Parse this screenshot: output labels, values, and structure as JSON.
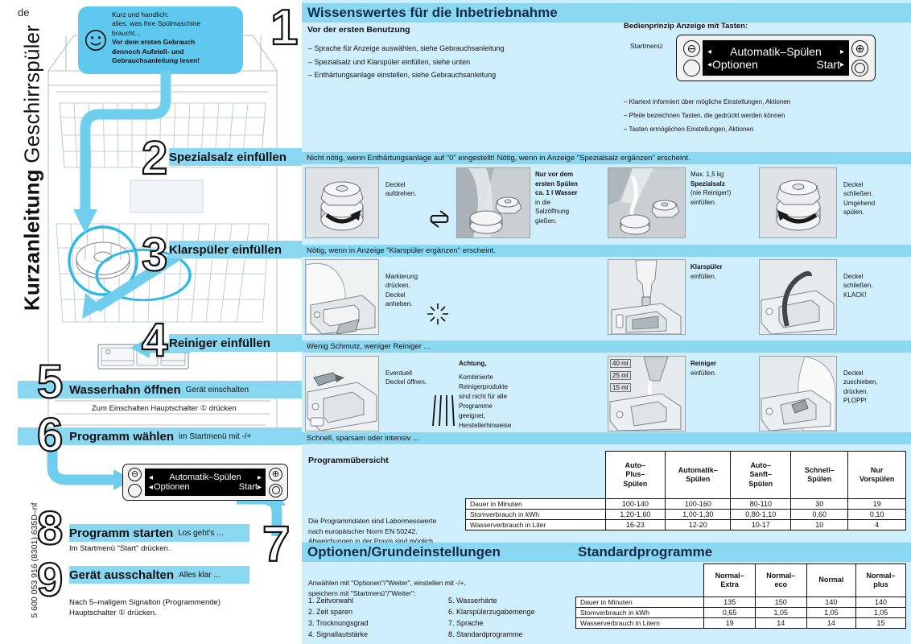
{
  "meta": {
    "language_code": "de",
    "doc_code": "5 600 053 916 (8301)   635D–nf",
    "vertical_title_bold": "Kurzanleitung",
    "vertical_title_thin": "Geschirrspüler"
  },
  "intro_bubble": {
    "icon": "smiley-icon",
    "line1": "Kurz und handlich:",
    "line2": "alles, was Ihre Spülmaschine",
    "line3": "braucht...",
    "bold1": "Vor dem ersten Gebrauch",
    "bold2": "dennoch Aufstell- und",
    "bold3": "Gebrauchsanleitung lesen!"
  },
  "steps": [
    {
      "num": "1",
      "title": "",
      "sub": "",
      "note": ""
    },
    {
      "num": "2",
      "title": "Spezialsalz einfüllen",
      "sub": "",
      "note": ""
    },
    {
      "num": "3",
      "title": "Klarspüler einfüllen",
      "sub": "",
      "note": ""
    },
    {
      "num": "4",
      "title": "Reiniger einfüllen",
      "sub": "",
      "note": ""
    },
    {
      "num": "5",
      "title": "Wasserhahn öffnen",
      "sub": "Gerät einschalten",
      "note": "Zum Einschalten Hauptschalter ① drücken"
    },
    {
      "num": "6",
      "title": "Programm wählen",
      "sub": "im Startmenü mit -/+",
      "note": ""
    },
    {
      "num": "7",
      "title": "",
      "sub": "",
      "note": ""
    },
    {
      "num": "8",
      "title": "Programm starten",
      "sub": "Los geht's ...",
      "note": "Im Startmenü \"Start\" drücken."
    },
    {
      "num": "9",
      "title": "Gerät ausschalten",
      "sub": "Alles klar ...",
      "note": "Nach 5–maligem Signalton (Programmende)\nHauptschalter ① drücken."
    }
  ],
  "display": {
    "minus": "⊖",
    "plus": "⊕",
    "blank_button": "blank-button",
    "ring_button": "ring-button",
    "row1_left_arrow": "◂",
    "row1_text": "Automatik–Spülen",
    "row1_right_arrow": "▸",
    "row2_left_arrow": "◂",
    "row2_text": "Optionen",
    "row2_right_text": "Start",
    "row2_right_arrow": "▸"
  },
  "section1": {
    "title": "Wissenswertes für die Inbetriebnahme",
    "subhead": "Vor der ersten Benutzung",
    "bullets": [
      "– Sprache für Anzeige auswählen, siehe Gebrauchsanleitung",
      "– Spezialsalz und Klarspüler einfüllen, siehe unten",
      "– Enthärtungsanlage einstellen, siehe Gebrauchsanleitung"
    ],
    "bedien_head": "Bedienprinzip Anzeige mit Tasten:",
    "startmenu_label": "Startmenü:",
    "bedien_notes": [
      "– Klartext informiert über mögliche Einstellungen, Aktionen",
      "– Pfeile bezeichnen Tasten, die gedrückt werden können",
      "– Tasten ermöglichen Einstellungen, Aktionen"
    ]
  },
  "row_salt": {
    "band": "Nicht nötig, wenn Enthärtungsanlage auf \"0\" eingestellt! Nötig, wenn in Anzeige \"Spezialsalz ergänzen\" erscheint.",
    "cap1": "Deckel\naufdrehen.",
    "cap2_bold": "Nur vor dem\nersten Spülen\nca. 1 l Wasser",
    "cap2_rest": "in die\nSalzöffnung\ngießen.",
    "cap3_pre": "Max. 1,5 kg",
    "cap3_bold": "Spezialsalz",
    "cap3_rest": "(nie Reiniger!)\neinfüllen.",
    "cap4": "Deckel\nschließen.\nUmgehend\nspülen.",
    "swap_icon": "swap-arrows-icon"
  },
  "row_rinse": {
    "band": "Nötig, wenn in Anzeige \"Klarspüler ergänzen\" erscheint.",
    "cap1": "Markierung\ndrücken,\nDeckel\nanheben.",
    "cap2_bold": "Klarspüler",
    "cap2_rest": "einfüllen.",
    "cap3": "Deckel\nschließen.\nKLACK!",
    "sparkle_icon": "sparkle-icon"
  },
  "row_detergent": {
    "band": "Wenig Schmutz, weniger Reiniger ...",
    "cap1": "Eventuell\nDeckel öffnen.",
    "cap2_bold": "Achtung,",
    "cap2_rest": "Kombinierte\nReinigerprodukte\nsind nicht für alle\nProgramme\ngeeignet,\nHerstellerhinweise\nbeachten.",
    "cap3_bold": "Reiniger",
    "cap3_rest": "einfüllen.",
    "cap4": "Deckel\nzuschieben,\ndrücken.\nPLOPP!",
    "ml_tags": [
      "40 ml",
      "25 ml",
      "15 ml"
    ],
    "rain_icon": "rain-lines-icon"
  },
  "row_programs": {
    "band": "Schnell, sparsam oder intensiv ...",
    "overview_title": "Programmübersicht",
    "note": "Die Programmdaten sind Labormesswerte\nnach europäischer Norm EN 50242.\nAbweichungen in der Praxis sind möglich."
  },
  "chart_data": {
    "type": "table",
    "title": "Programmübersicht",
    "columns": [
      "Auto–\nPlus–\nSpülen",
      "Automatik–\nSpülen",
      "Auto–\nSanft–\nSpülen",
      "Schnell–\nSpülen",
      "Nur\nVorspülen"
    ],
    "rows": [
      {
        "label": "Dauer in Minuten",
        "values": [
          "100-140",
          "100-160",
          "80-110",
          "30",
          "19"
        ]
      },
      {
        "label": "Stomverbrauch in kWh",
        "values": [
          "1,20-1,60",
          "1,00-1,30",
          "0,80-1,10",
          "0,60",
          "0,10"
        ]
      },
      {
        "label": "Wasserverbrauch in Liter",
        "values": [
          "16-23",
          "12-20",
          "10-17",
          "10",
          "4"
        ]
      }
    ]
  },
  "standard": {
    "title": "Standardprogramme",
    "columns": [
      "Normal–\nExtra",
      "Normal–\neco",
      "Normal",
      "Normal–\nplus"
    ],
    "rows": [
      {
        "label": "Dauer in Minuten",
        "values": [
          "135",
          "150",
          "140",
          "140"
        ]
      },
      {
        "label": "Stomverbrauch in kWh",
        "values": [
          "0,65",
          "1,05",
          "1,05",
          "1,05"
        ]
      },
      {
        "label": "Wasserverbrauch in Litern",
        "values": [
          "19",
          "14",
          "14",
          "15"
        ]
      }
    ]
  },
  "options": {
    "title": "Optionen/Grundeinstellungen",
    "intro": "Anwählen mit \"Optionen\"/\"Weiter\", einstellen mit -/+,\nspeichern mit \"Startmenü\"/\"Weiter\":",
    "list_left": [
      "1. Zeitvorwahl",
      "2. Zeit sparen",
      "3. Trocknungsgrad",
      "4. Signallautstärke"
    ],
    "list_right": [
      "5. Wasserhärte",
      "6. Klarspülerzugabemenge",
      "7. Sprache",
      "8. Standardprogramme"
    ]
  },
  "colors": {
    "panel_bg": "#cfeefc",
    "band_blue": "#8ad7f2",
    "accent_blue": "#29b8e8",
    "title_text": "#13294b"
  }
}
